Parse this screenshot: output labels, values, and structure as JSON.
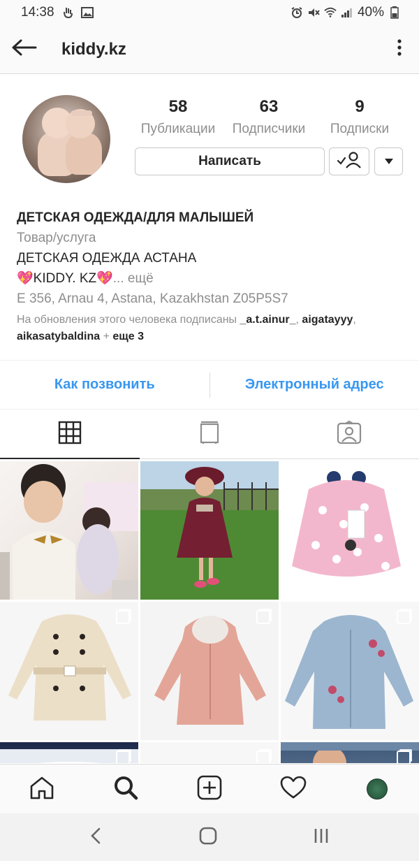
{
  "status_bar": {
    "time": "14:38",
    "battery": "40%"
  },
  "header": {
    "title": "kiddy.kz"
  },
  "profile": {
    "stats": [
      {
        "value": "58",
        "label": "Публикации"
      },
      {
        "value": "63",
        "label": "Подписчики"
      },
      {
        "value": "9",
        "label": "Подписки"
      }
    ],
    "message_button": "Написать",
    "bio": {
      "name": "ДЕТСКАЯ ОДЕЖДА/ДЛЯ МАЛЫШЕЙ",
      "category": "Товар/услуга",
      "line1": "ДЕТСКАЯ ОДЕЖДА АСТАНА",
      "line2": "💖KIDDY. KZ💖",
      "more": "... ещё",
      "address": "E 356, Arnau 4, Astana, Kazakhstan Z05P5S7",
      "followed_prefix": "На обновления этого человека подписаны ",
      "followed_user1": "_a.t.ainur_",
      "followed_sep1": ", ",
      "followed_user2": "aigatayyy",
      "followed_sep2": ", ",
      "followed_user3": "aikasatybaldina",
      "followed_sep3": " + ",
      "followed_more": "еще 3"
    }
  },
  "contact": {
    "call": "Как позвонить",
    "email": "Электронный адрес"
  },
  "tabs": [
    {
      "icon": "grid-icon",
      "active": true
    },
    {
      "icon": "igtv-icon",
      "active": false
    },
    {
      "icon": "tagged-icon",
      "active": false
    }
  ],
  "colors": {
    "link_blue": "#3897f0",
    "text_dark": "#262626",
    "text_muted": "#8e8e8e"
  }
}
